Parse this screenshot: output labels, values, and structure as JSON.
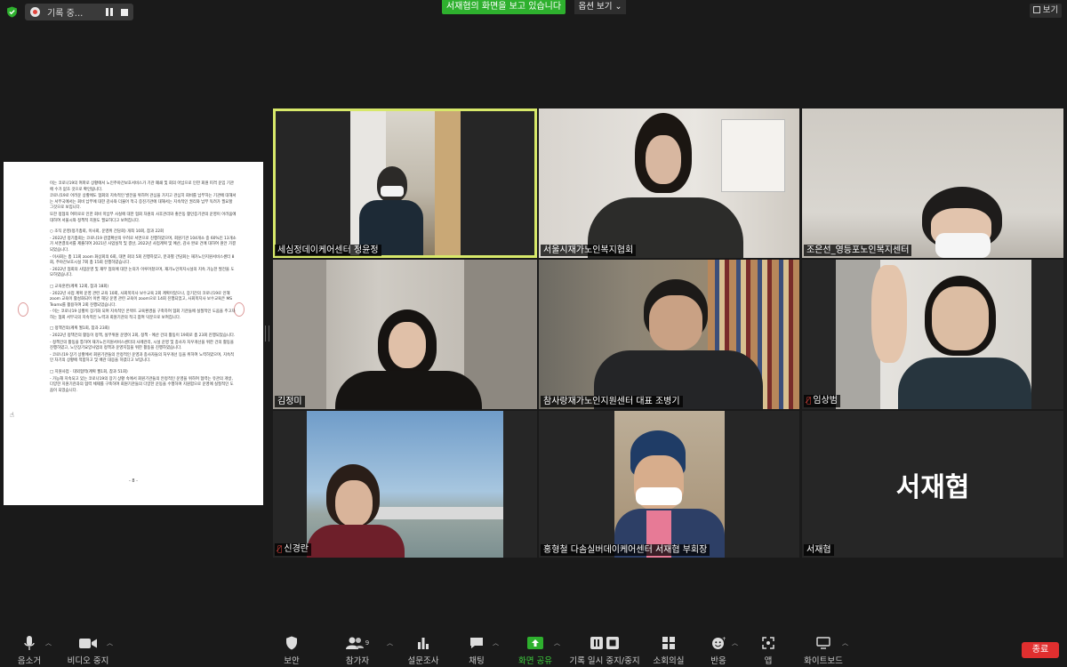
{
  "topbar": {
    "recording_label": "기록 중...",
    "sharing_banner": "서재협의 화면을 보고 있습니다",
    "view_options": "옵션 보기",
    "view_button": "보기"
  },
  "document": {
    "paragraphs": [
      "이는 코로나19의 여파로 상황에서 노인주야간보호서비스가 기관 폐쇄 및 회의 어납으로 인한 회원 피격 운임 기관에 수가 없조 것으로 확인됩니다.",
      "코로나19로 어려운 상황에도 협회의 지속적인 발전을 위하여 관심을 가지고 관심히 회비를 납부하는 기관에 대해서는 서무국에서는 회비 납부에 대한 감사와 더불어 적극 증진기관에 대해서는 지속적인 권리와 납부 독려가 필요할 그것으로 보입니다.",
      "또한 정협의 여파로로 인한 회비 미납부 사실에 대한 협회 차원의 사후관리와 좋은동 활인증기관의 운영이 어려움에 대하여 서울시와 정책적 지원도 필요하다고 보여집니다."
    ],
    "sections": [
      "○ 조직 운영(정기총회, 이사회, 운영위 간담회) 개최 10회, 참과 22회",
      "- 2022년 정기총회는 코로나19 감염확산의 우려로 서면으로 진행하였으며, 회원기관 104개소 중 60%인 13개소가 서면결의서를 제출하여 2021년 사업실적 및 결산, 2022년 사업계획 및 예산, 감사 완료 건에 대하여 원안 가결되었습니다.",
      "- 이사회는 총 11회 zoom 화상회의 6회, 대면 회의 5회 진행하였고, 분과별 간담회는 재가노인지원서비스센터 8회, 주야간보호시설 7회 총 15회 진행하였습니다.",
      "- 2022년 협회의 사업운영 및 재무 협의에 대한 논의가 이루어졌으며, 재가노인복지시설의 지속 가능한 발전을 도모하였습니다.",
      "□ 교육훈련(계획 12회, 참과 18회)",
      "- 2022년 사업 계획 운영 관련 교육 10회, 사회복지사 보수교육 2회 계획이었으나, 장기간의 코로나19로 인해 zoom 교육이 활성화되어 이번 해당 운영 관련 교육이 zoom으로 14회 진행되었고, 사회복지사 보수교육은 MS Teams를 활용하여 2회 진행되었습니다.",
      "- 이는 코로나19 상황이 장기화 되며 지속적인 온택트 교육환경을 구축하여 협회 기관들에 실질적인 도움을 주고자 하는 협회 서무국의 지속적인 노력과 회원기관의 적극 참여 덕분으로 보여집니다.",
      "□ 정책건의(계획 월1회, 참과 23회)",
      "- 2022년 정책건의 활동이 정책, 실무위원 운영이 2회, 정책 - 예산 건의 활동이 19회로 총 23회 진행되었습니다.",
      "- 정책건의 활동을 통하여 재가노인지원서비스센터의 사례관리, 시설 운영 및 종사자 처우개선을 위한 건의 활동을 진행하였고, 노인장기요양사업의 정책과 운영지침을 위한 활동을 진행하였습니다.",
      "- 코로나19 장기 상황에서 회원기관들의 안정적인 운영과 종사자들의 처우개선 등을 위하여 노력하였으며, 지속적인 차기의 상황에 적합하고 및 배관 대응을 하였다고 보입니다.",
      "□ 지원사업 · 대외협력(계획 월1회, 참과 51회)",
      "- 가능해 지속되고 있는 코로나19의 장기 상황 속에서 회원기관들의 안정적인 운영을 위하여 협력는 유관의 개방, 다양한 지원기관과의 협력 체제를 구축하여 회원기관들의 다양한 운동을 수행하며 지원함으로 운영에 실질적인 도움이 되었습니다."
    ],
    "page_number": "- 8 -"
  },
  "participants": [
    {
      "name": "세심정데이케어센터 정윤정",
      "muted": false,
      "active": true
    },
    {
      "name": "서울시재가노인복지협회",
      "muted": false,
      "active": false
    },
    {
      "name": "조은선_영등포노인복지센터",
      "muted": false,
      "active": false
    },
    {
      "name": "김정미",
      "muted": false,
      "active": false
    },
    {
      "name": "참사랑재가노인지원센터 대표 조병기",
      "muted": false,
      "active": false
    },
    {
      "name": "임상범",
      "muted": true,
      "active": false
    },
    {
      "name": "신경란",
      "muted": true,
      "active": false
    },
    {
      "name": "홍형철 다솜실버데이케어센터 서재협 부회장",
      "muted": false,
      "active": false
    },
    {
      "name": "서재협",
      "muted": false,
      "active": false,
      "avatar_text": "서재협"
    }
  ],
  "toolbar": {
    "mute": "음소거",
    "video_stop": "비디오 중지",
    "security": "보안",
    "participants": "참가자",
    "participants_count": "9",
    "polls": "설문조사",
    "chat": "채팅",
    "share_screen": "화면 공유",
    "pause_share": "기록 일시 중지/중지",
    "breakout": "소회의실",
    "reactions": "반응",
    "apps": "앱",
    "whiteboard": "화이트보드",
    "end": "종료"
  },
  "colors": {
    "active_speaker_border": "#d7e86a",
    "sharing_banner": "#2eb02e",
    "share_screen_icon": "#2eb02e",
    "end_button": "#e02f2f",
    "muted_icon": "#e0443c"
  }
}
